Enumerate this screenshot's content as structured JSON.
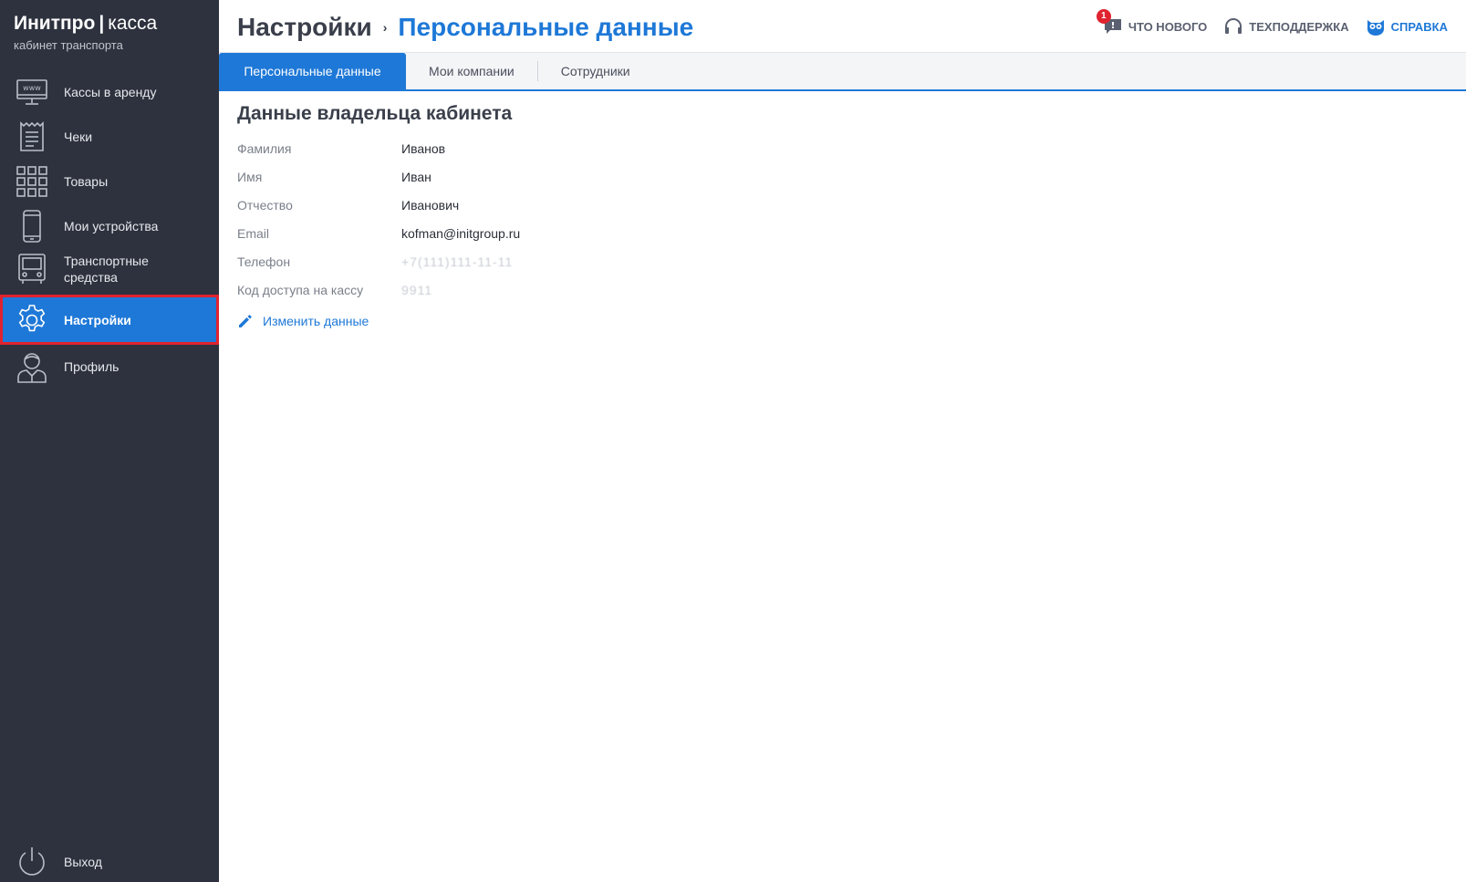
{
  "brand": {
    "name": "Инитпро",
    "separator": "|",
    "product": "касса",
    "subtitle": "кабинет транспорта"
  },
  "sidebar": {
    "items": [
      {
        "label": "Кассы в аренду",
        "icon": "www-terminal-icon"
      },
      {
        "label": "Чеки",
        "icon": "receipt-icon"
      },
      {
        "label": "Товары",
        "icon": "grid-icon"
      },
      {
        "label": "Мои устройства",
        "icon": "phone-icon"
      },
      {
        "label": "Транспортные средства",
        "icon": "bus-icon"
      },
      {
        "label": "Настройки",
        "icon": "gear-icon",
        "active": true
      },
      {
        "label": "Профиль",
        "icon": "user-icon"
      }
    ],
    "logout": {
      "label": "Выход",
      "icon": "power-icon"
    }
  },
  "header": {
    "breadcrumb_root": "Настройки",
    "breadcrumb_arrow": "›",
    "breadcrumb_current": "Персональные данные",
    "whats_new": {
      "label": "ЧТО НОВОГО",
      "badge": "1"
    },
    "support": {
      "label": "ТЕХПОДДЕРЖКА"
    },
    "help": {
      "label": "СПРАВКА"
    }
  },
  "tabs": [
    {
      "label": "Персональные данные",
      "active": true
    },
    {
      "label": "Мои компании"
    },
    {
      "label": "Сотрудники"
    }
  ],
  "main": {
    "section_title": "Данные владельца кабинета",
    "fields": [
      {
        "label": "Фамилия",
        "value": "Иванов"
      },
      {
        "label": "Имя",
        "value": "Иван"
      },
      {
        "label": "Отчество",
        "value": "Иванович"
      },
      {
        "label": "Email",
        "value": "kofman@initgroup.ru"
      },
      {
        "label": "Телефон",
        "value": "+7(111)111-11-11"
      },
      {
        "label": "Код доступа на кассу",
        "value": "9911"
      }
    ],
    "edit_label": "Изменить данные"
  },
  "colors": {
    "sidebar_bg": "#2d323e",
    "accent": "#1e78d7",
    "highlight_border": "#e0232e"
  }
}
